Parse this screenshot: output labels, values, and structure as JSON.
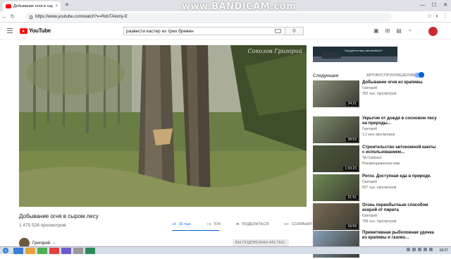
{
  "browser": {
    "tab_title": "Добывание огня в сыр...",
    "tab_close": "×",
    "new_tab": "+",
    "url": "https://www.youtube.com/watch?v=RdnTAIomy-E",
    "watermark": "www.BANDICAM.com",
    "window_controls": [
      "—",
      "☐",
      "✕"
    ]
  },
  "youtube": {
    "logo_text": "YouTube",
    "search_value": "развести кастер из трех бревен"
  },
  "video": {
    "watermark": "Соколов Григорий",
    "title": "Добывание огня в сыром лесу",
    "views": "1 475 528 просмотров",
    "likes": "31 тыс.",
    "dislikes": "574",
    "like_ratio": 0.98,
    "share_label": "ПОДЕЛИТЬСЯ",
    "save_label": "СОХРАНИТЬ",
    "more_label": "···",
    "channel_name": "Григорий",
    "subscribe_label": "ВЫ ПОДПИСАНЫ 449 ТЫС."
  },
  "sidebar": {
    "ad_text": "Продается ваш автомобиль?",
    "up_next": "Следующее",
    "autoplay": "АВТОВОСПРОИЗВЕДЕНИЕ",
    "items": [
      {
        "title": "Добывание огня из крапивы",
        "channel": "Григорий",
        "meta": "352 тыс. просмотров",
        "duration": "24:21",
        "color": "#8a8f7a"
      },
      {
        "title": "Укрытие от дождя в сосновом лесу на природы...",
        "channel": "Григорий",
        "meta": "1,2 млн просмотров",
        "duration": "28:53",
        "color": "#7a8a6e"
      },
      {
        "title": "Строительство автономной каюты с использованием...",
        "channel": "TA Outdoors",
        "meta": "Рекомендованные вам",
        "duration": "1:03:23",
        "color": "#4a5a3a"
      },
      {
        "title": "Рогоз. Доступная еда в природе.",
        "channel": "Григорий",
        "meta": "657 тыс. просмотров",
        "duration": "21:51",
        "color": "#6e8a56"
      },
      {
        "title": "Огонь первобытным способом искрой от пирита",
        "channel": "Григорий",
        "meta": "799 тыс. просмотров",
        "duration": "16:59",
        "color": "#7a6a56"
      },
      {
        "title": "Примитивная рыболовная удочка из крапивы и газово...",
        "channel": "",
        "meta": "",
        "duration": "",
        "color": "#88a0b8"
      }
    ]
  },
  "taskbar": {
    "clock": "18:37"
  }
}
